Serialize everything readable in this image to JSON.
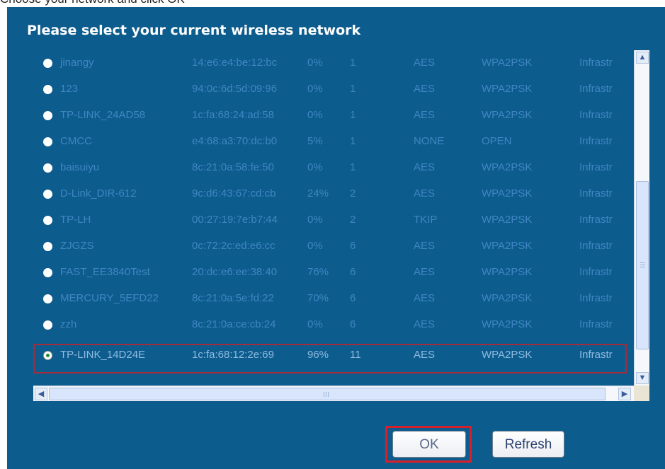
{
  "top_text": "Choose your network and click OK",
  "heading": "Please select your current wireless network",
  "networks": [
    {
      "ssid": "jinangy",
      "mac": "14:e6:e4:be:12:bc",
      "signal": "0%",
      "channel": "1",
      "encryption": "AES",
      "auth": "WPA2PSK",
      "mode": "Infrastr"
    },
    {
      "ssid": "123",
      "mac": "94:0c:6d:5d:09:96",
      "signal": "0%",
      "channel": "1",
      "encryption": "AES",
      "auth": "WPA2PSK",
      "mode": "Infrastr"
    },
    {
      "ssid": "TP-LINK_24AD58",
      "mac": "1c:fa:68:24:ad:58",
      "signal": "0%",
      "channel": "1",
      "encryption": "AES",
      "auth": "WPA2PSK",
      "mode": "Infrastr"
    },
    {
      "ssid": "CMCC",
      "mac": "e4:68:a3:70:dc:b0",
      "signal": "5%",
      "channel": "1",
      "encryption": "NONE",
      "auth": "OPEN",
      "mode": "Infrastr"
    },
    {
      "ssid": "baisuiyu",
      "mac": "8c:21:0a:58:fe:50",
      "signal": "0%",
      "channel": "1",
      "encryption": "AES",
      "auth": "WPA2PSK",
      "mode": "Infrastr"
    },
    {
      "ssid": "D-Link_DIR-612",
      "mac": "9c:d6:43:67:cd:cb",
      "signal": "24%",
      "channel": "2",
      "encryption": "AES",
      "auth": "WPA2PSK",
      "mode": "Infrastr"
    },
    {
      "ssid": "TP-LH",
      "mac": "00:27:19:7e:b7:44",
      "signal": "0%",
      "channel": "2",
      "encryption": "TKIP",
      "auth": "WPA2PSK",
      "mode": "Infrastr"
    },
    {
      "ssid": "ZJGZS",
      "mac": "0c:72:2c:ed:e6:cc",
      "signal": "0%",
      "channel": "6",
      "encryption": "AES",
      "auth": "WPA2PSK",
      "mode": "Infrastr"
    },
    {
      "ssid": "FAST_EE3840Test",
      "mac": "20:dc:e6:ee:38:40",
      "signal": "76%",
      "channel": "6",
      "encryption": "AES",
      "auth": "WPA2PSK",
      "mode": "Infrastr"
    },
    {
      "ssid": "MERCURY_5EFD22",
      "mac": "8c:21:0a:5e:fd:22",
      "signal": "70%",
      "channel": "6",
      "encryption": "AES",
      "auth": "WPA2PSK",
      "mode": "Infrastr"
    },
    {
      "ssid": "zzh",
      "mac": "8c:21:0a:ce:cb:24",
      "signal": "0%",
      "channel": "6",
      "encryption": "AES",
      "auth": "WPA2PSK",
      "mode": "Infrastr"
    },
    {
      "ssid": "TP-LINK_14D24E",
      "mac": "1c:fa:68:12:2e:69",
      "signal": "96%",
      "channel": "11",
      "encryption": "AES",
      "auth": "WPA2PSK",
      "mode": "Infrastr",
      "selected": true
    }
  ],
  "buttons": {
    "ok": "OK",
    "refresh": "Refresh"
  },
  "icons": {
    "scroll_up": "chevron-up-icon",
    "scroll_down": "chevron-down-icon",
    "scroll_left": "chevron-left-icon",
    "scroll_right": "chevron-right-icon",
    "hscroll_grip": "III"
  },
  "colors": {
    "panel_bg": "#0d5c8e",
    "row_text": "#3f86c2",
    "selection_border": "#a32d3a",
    "ok_highlight": "#d9202a"
  }
}
